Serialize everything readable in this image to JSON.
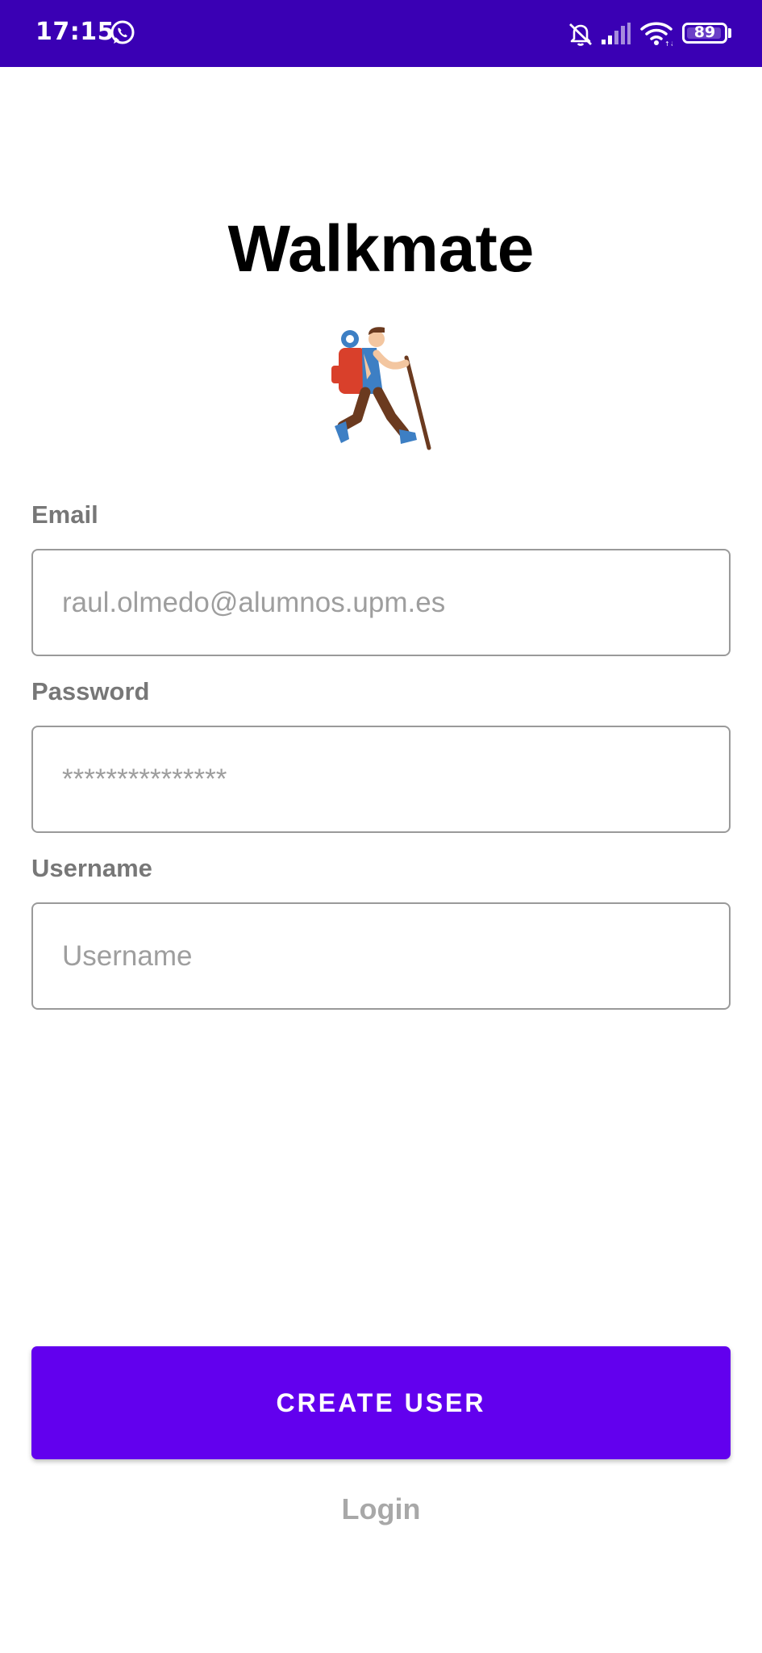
{
  "status_bar": {
    "time": "17:15",
    "battery": "89",
    "icons": [
      "whatsapp-icon",
      "muted-bell-icon",
      "signal-icon",
      "wifi-icon",
      "battery-icon"
    ]
  },
  "app": {
    "title": "Walkmate",
    "logo_icon": "hiker-icon"
  },
  "form": {
    "email": {
      "label": "Email",
      "placeholder": "raul.olmedo@alumnos.upm.es",
      "value": ""
    },
    "password": {
      "label": "Password",
      "placeholder": "***************",
      "value": ""
    },
    "username": {
      "label": "Username",
      "placeholder": "Username",
      "value": ""
    }
  },
  "actions": {
    "create_user_label": "CREATE USER",
    "login_label": "Login"
  },
  "colors": {
    "status_bar": "#3a00b4",
    "primary": "#6200ee",
    "label": "#777777",
    "placeholder": "#9e9e9e",
    "link": "#a8a8a8"
  }
}
